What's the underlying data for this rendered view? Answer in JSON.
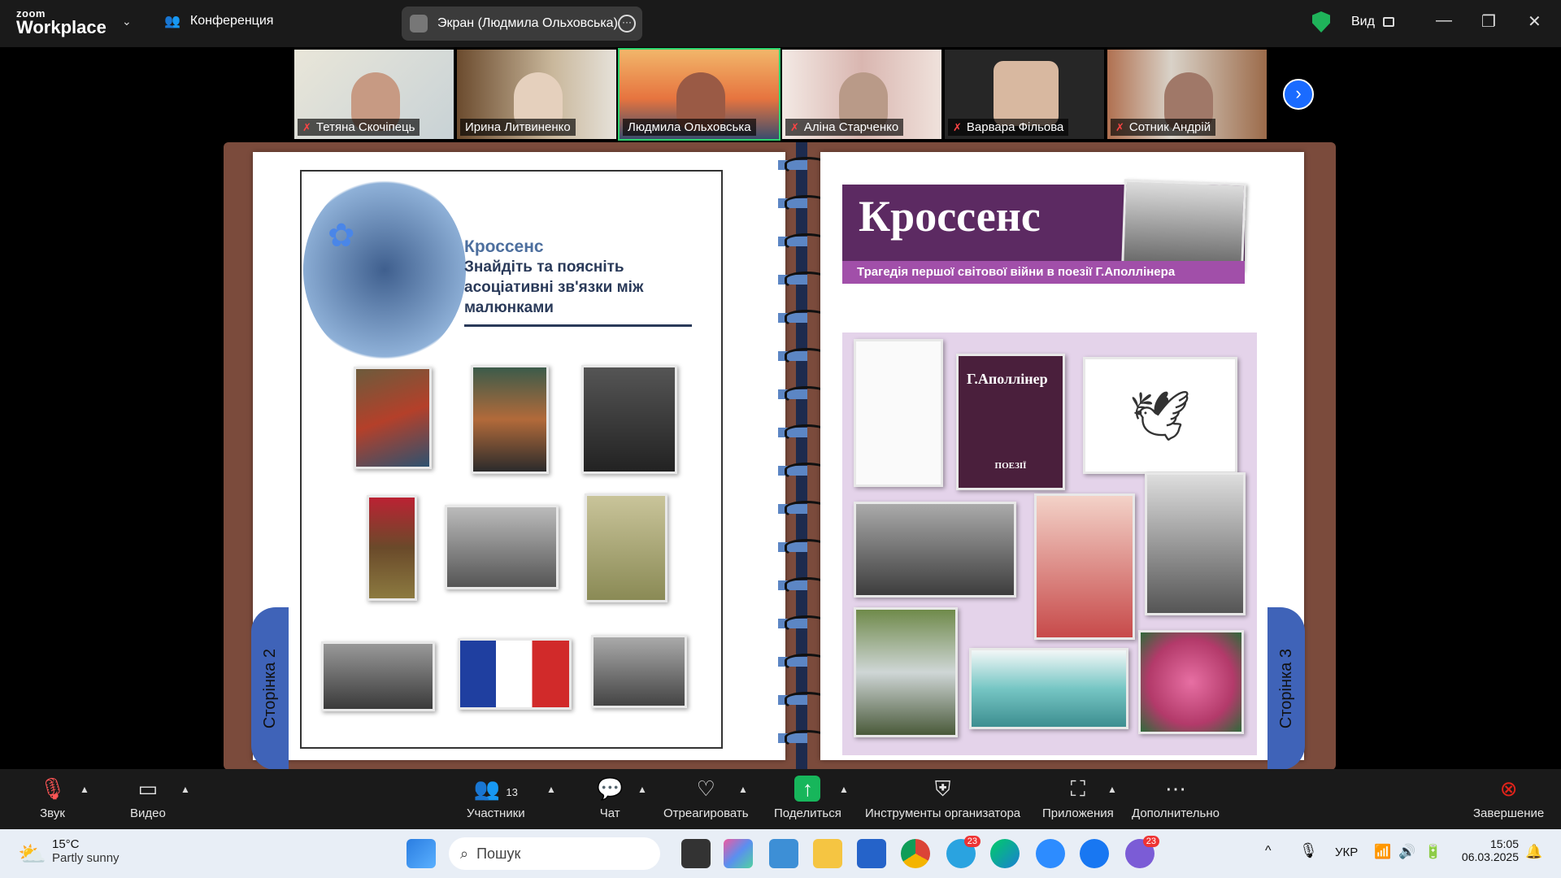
{
  "topbar": {
    "brand_top": "zoom",
    "brand_bottom": "Workplace",
    "conference": "Конференция",
    "screen_share_label": "Экран (Людмила Ольховська)",
    "view_label": "Вид"
  },
  "participants_strip": [
    {
      "name": "Тетяна Скочіпець",
      "muted": true
    },
    {
      "name": "Ирина Литвиненко",
      "muted": false
    },
    {
      "name": "Людмила Ольховська",
      "muted": false,
      "active": true
    },
    {
      "name": "Аліна Старченко",
      "muted": true
    },
    {
      "name": "Варвара Фільова",
      "muted": true
    },
    {
      "name": "Сотник Андрій",
      "muted": true
    }
  ],
  "shared": {
    "left": {
      "heading": "Кроссенс",
      "instruction": "Знайдіть та поясніть асоціативні зв'язки між малюнками",
      "page_tab": "Сторінка 2"
    },
    "right": {
      "heading": "Кроссенс",
      "subtitle": "Трагедія першої світової війни в поезії Г.Аполлінера",
      "page_tab": "Сторінка 3",
      "book_title": "Г.Аполлінер",
      "book_sub": "ПОЕЗІЇ"
    }
  },
  "toolbar": {
    "audio": "Звук",
    "video": "Видео",
    "participants": "Участники",
    "participants_count": "13",
    "chat": "Чат",
    "react": "Отреагировать",
    "share": "Поделиться",
    "host_tools": "Инструменты организатора",
    "apps": "Приложения",
    "more": "Дополнительно",
    "end": "Завершение"
  },
  "taskbar": {
    "weather_temp": "15°C",
    "weather_desc": "Partly sunny",
    "search_placeholder": "Пошук",
    "telegram_badge": "23",
    "viber_badge": "23",
    "language": "УКР",
    "time": "15:05",
    "date": "06.03.2025"
  },
  "colors": {
    "accent_green": "#2dd36f",
    "share_blue": "#1a6bff",
    "end_red": "#e2231a"
  }
}
